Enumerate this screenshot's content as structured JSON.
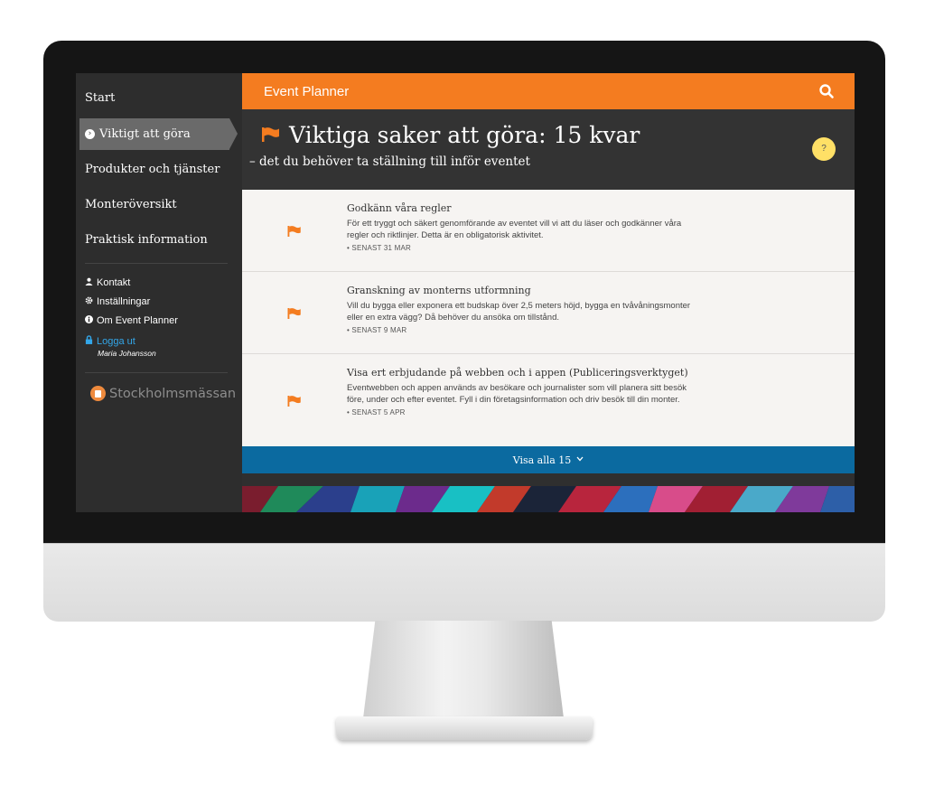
{
  "sidebar": {
    "nav": [
      {
        "label": "Start"
      },
      {
        "label": "Viktigt att göra"
      },
      {
        "label": "Produkter och tjänster"
      },
      {
        "label": "Monteröversikt"
      },
      {
        "label": "Praktisk information"
      }
    ],
    "utilities": [
      {
        "label": "Kontakt",
        "icon": "user-icon"
      },
      {
        "label": "Inställningar",
        "icon": "gear-icon"
      },
      {
        "label": "Om Event Planner",
        "icon": "info-icon"
      },
      {
        "label": "Logga ut",
        "icon": "lock-icon"
      }
    ],
    "user_name": "Maria Johansson",
    "brand": "Stockholmsmässan"
  },
  "header": {
    "app_title": "Event Planner",
    "page_title": "Viktiga saker att göra: 15 kvar",
    "subtitle": "– det du behöver ta ställning till inför eventet",
    "help_label": "?"
  },
  "tasks": [
    {
      "title": "Godkänn våra regler",
      "description": "För ett tryggt och säkert genomförande av eventet vill vi att du läser och godkänner våra regler och riktlinjer. Detta är en obligatorisk aktivitet.",
      "deadline": "• SENAST 31 MAR"
    },
    {
      "title": "Granskning av monterns utformning",
      "description": "Vill du bygga eller exponera ett budskap över 2,5 meters höjd, bygga en tvåvåningsmonter eller en extra vägg? Då behöver du ansöka om tillstånd.",
      "deadline": "• SENAST 9 MAR"
    },
    {
      "title": "Visa ert erbjudande på webben och i appen (Publiceringsverktyget)",
      "description": "Eventwebben och appen används av besökare och journalister som vill planera sitt besök före, under och efter eventet. Fyll i din företagsinformation och driv besök till din monter.",
      "deadline": "• SENAST 5 APR"
    }
  ],
  "show_all_label": "Visa alla 15",
  "colors": {
    "accent": "#f47c20",
    "show_all": "#0b6aa0",
    "help": "#ffe066",
    "logout": "#33a6e8"
  }
}
